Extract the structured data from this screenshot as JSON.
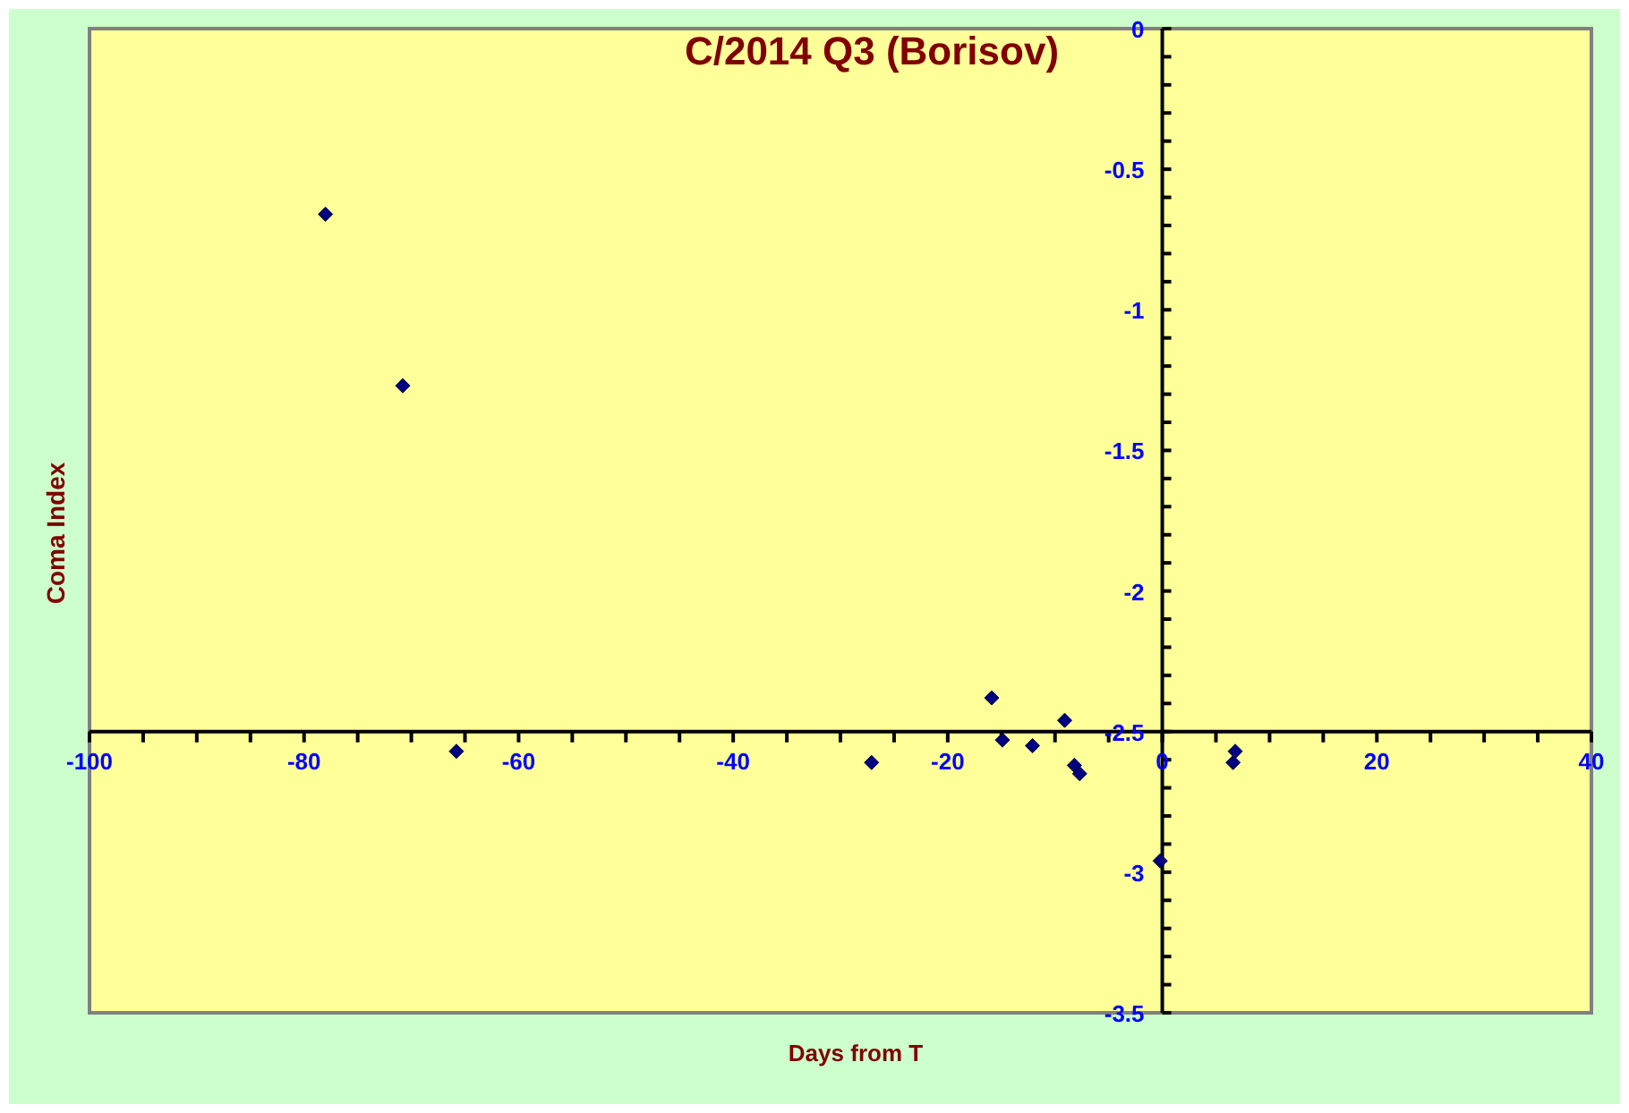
{
  "chart": {
    "chart_data": {
      "type": "scatter",
      "title": "C/2014 Q3 (Borisov)",
      "xlabel": "Days from T",
      "ylabel": "Coma Index",
      "x": [
        -78,
        -70.8,
        -65.8,
        -27.1,
        -15.9,
        -14.9,
        -12.1,
        -9.1,
        -8.2,
        -7.7,
        -0.2,
        6.8,
        6.6
      ],
      "series": [
        {
          "color": "#000080",
          "values": [
            -0.66,
            -1.27,
            -2.57,
            -2.61,
            -2.38,
            -2.53,
            -2.55,
            -2.46,
            -2.62,
            -2.65,
            -2.96,
            -2.57,
            -2.61
          ]
        }
      ],
      "xlim": [
        -100,
        40
      ],
      "ylim": [
        -3.5,
        0
      ],
      "xticks": [
        -100,
        -80,
        -60,
        -40,
        -20,
        0,
        20,
        40
      ],
      "yticks": [
        0,
        -0.5,
        -1,
        -1.5,
        -2,
        -2.5,
        -3,
        -3.5
      ]
    }
  }
}
